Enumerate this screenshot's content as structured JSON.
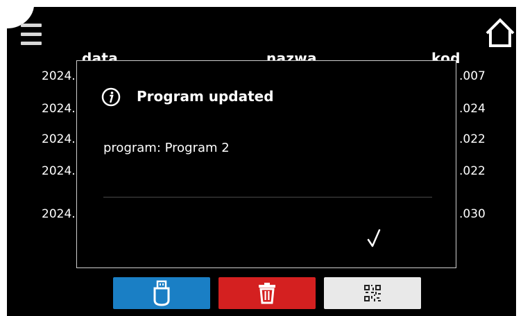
{
  "header": {
    "col_date": "data",
    "col_name": "nazwa",
    "col_code": "kod"
  },
  "rows": [
    {
      "date": "2024.",
      "code": ".007"
    },
    {
      "date": "2024.",
      "code": ".024"
    },
    {
      "date": "2024.",
      "code": ".022"
    },
    {
      "date": "2024.",
      "code": ".022"
    },
    {
      "date": "2024.",
      "code": ".030"
    }
  ],
  "dialog": {
    "title": "Program updated",
    "message": "program: Program 2",
    "confirm_icon": "checkmark-icon"
  },
  "toolbar": {
    "usb_icon": "usb-icon",
    "delete_icon": "trash-icon",
    "qr_icon": "qr-code-icon"
  },
  "colors": {
    "background": "#000000",
    "usb_button": "#1a7fc5",
    "delete_button": "#d42020",
    "qr_button": "#e9e9e9"
  }
}
